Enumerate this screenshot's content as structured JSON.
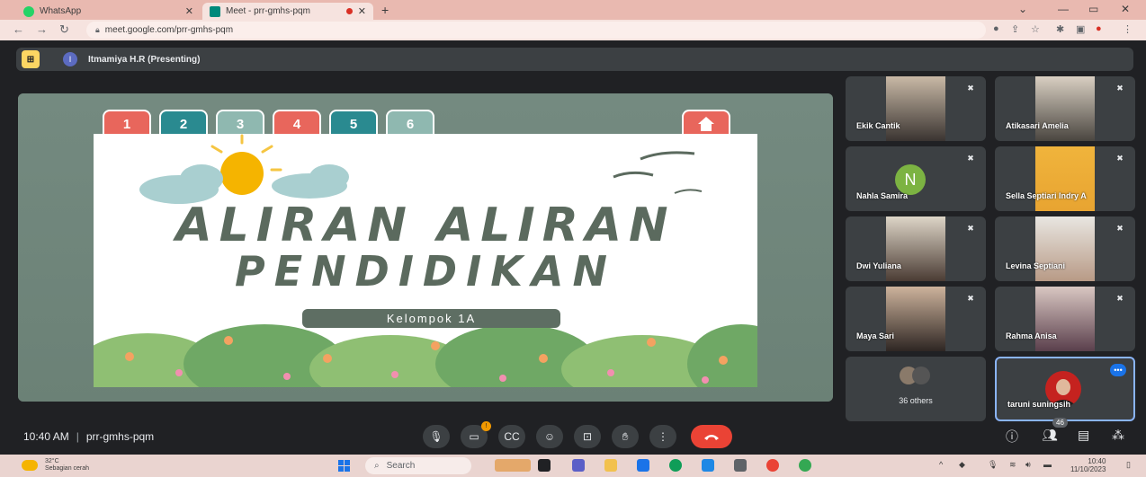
{
  "browser": {
    "tabs": [
      {
        "label": "WhatsApp",
        "active": false
      },
      {
        "label": "Meet - prr-gmhs-pqm",
        "active": true
      }
    ],
    "url": "meet.google.com/prr-gmhs-pqm"
  },
  "meet": {
    "presenter_initial": "I",
    "presenter_label": "Itmamiya H.R (Presenting)",
    "slide": {
      "tabs": [
        "1",
        "2",
        "3",
        "4",
        "5",
        "6"
      ],
      "title_line1": "ALIRAN ALIRAN",
      "title_line2": "PENDIDIKAN",
      "group": "Kelompok 1A"
    },
    "participants": [
      {
        "name": "Ekik Cantik",
        "muted": true
      },
      {
        "name": "Atikasari Amelia",
        "muted": true
      },
      {
        "name": "Nahla Samira",
        "muted": true,
        "avatar_letter": "N"
      },
      {
        "name": "Sella Septiari Indry A",
        "muted": true
      },
      {
        "name": "Dwi Yuliana",
        "muted": true
      },
      {
        "name": "Levina Septiani",
        "muted": true
      },
      {
        "name": "Maya Sari",
        "muted": true
      },
      {
        "name": "Rahma Anisa",
        "muted": true
      }
    ],
    "others_label": "36 others",
    "self_name": "taruni suningsih",
    "time": "10:40 AM",
    "meeting_code": "prr-gmhs-pqm",
    "people_count": "46"
  },
  "taskbar": {
    "temp": "32°C",
    "weather": "Sebagian cerah",
    "search_placeholder": "Search",
    "time": "10:40",
    "date": "11/10/2023"
  },
  "colors": {
    "meet_bg": "#202124",
    "end_call": "#ea4335",
    "tab_red": "#e8665c",
    "tab_teal": "#2a8a90"
  }
}
